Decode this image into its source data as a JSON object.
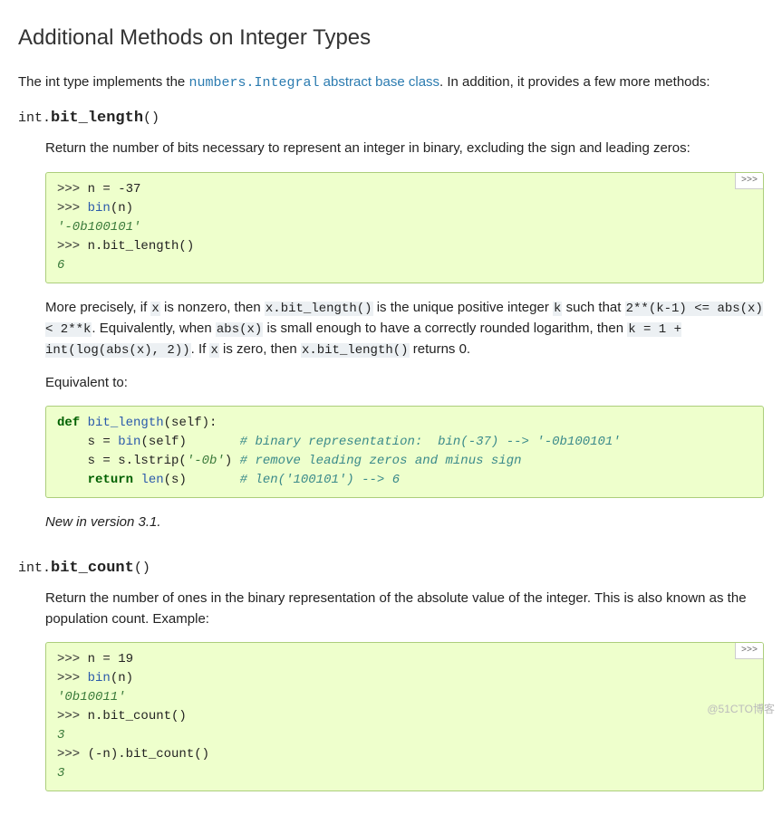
{
  "section": {
    "title": "Additional Methods on Integer Types",
    "intro_prefix": "The int type implements the ",
    "intro_link_code": "numbers.Integral",
    "intro_link_text": " abstract base class",
    "intro_suffix": ". In addition, it provides a few more methods:"
  },
  "bit_length": {
    "classprefix": "int.",
    "name": "bit_length",
    "parens": "()",
    "desc": "Return the number of bits necessary to represent an integer in binary, excluding the sign and leading zeros:",
    "example": {
      "p1": ">>> ",
      "l1": "n = -37",
      "p2": ">>> ",
      "l2_fn": "bin",
      "l2_arg": "(n)",
      "o2": "'-0b100101'",
      "p3": ">>> ",
      "l3": "n.bit_length()",
      "o3": "6",
      "toggle": ">>>"
    },
    "more1_a": "More precisely, if ",
    "more1_x": "x",
    "more1_b": " is nonzero, then ",
    "more1_c1": "x.bit_length()",
    "more1_c": " is the unique positive integer ",
    "more1_k": "k",
    "more1_d": " such that ",
    "more1_c2": "2**(k-1) <= abs(x) < 2**k",
    "more1_e": ". Equivalently, when ",
    "more1_c3": "abs(x)",
    "more1_f": " is small enough to have a correctly rounded logarithm, then ",
    "more1_c4": "k = 1 + int(log(abs(x), 2))",
    "more1_g": ". If ",
    "more1_x2": "x",
    "more1_h": " is zero, then ",
    "more1_c5": "x.bit_length()",
    "more1_i": " returns 0.",
    "equiv_label": "Equivalent to:",
    "equiv_code": {
      "kw_def": "def",
      "fn": " bit_length",
      "sig": "(self):",
      "l2a": "    s = ",
      "l2fn": "bin",
      "l2b": "(self)       ",
      "l2cmt": "# binary representation:  bin(-37) --> '-0b100101'",
      "l3a": "    s = s.lstrip(",
      "l3s": "'-0b'",
      "l3b": ") ",
      "l3cmt": "# remove leading zeros and minus sign",
      "l4a": "    ",
      "kw_ret": "return",
      "l4b": " ",
      "l4fn": "len",
      "l4c": "(s)       ",
      "l4cmt": "# len('100101') --> 6"
    },
    "versionadded": "New in version 3.1."
  },
  "bit_count": {
    "classprefix": "int.",
    "name": "bit_count",
    "parens": "()",
    "desc": "Return the number of ones in the binary representation of the absolute value of the integer. This is also known as the population count. Example:",
    "example": {
      "p1": ">>> ",
      "l1": "n = 19",
      "p2": ">>> ",
      "l2_fn": "bin",
      "l2_arg": "(n)",
      "o2": "'0b10011'",
      "p3": ">>> ",
      "l3": "n.bit_count()",
      "o3": "3",
      "p4": ">>> ",
      "l4": "(-n).bit_count()",
      "o4": "3",
      "toggle": ">>>"
    }
  },
  "watermark": "@51CTO博客"
}
